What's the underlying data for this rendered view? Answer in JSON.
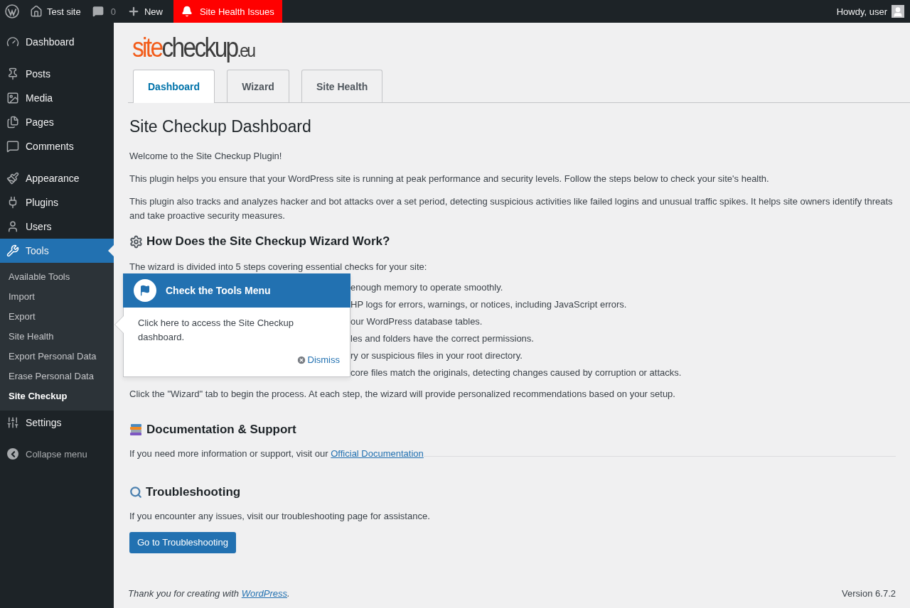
{
  "admin_bar": {
    "site": "Test site",
    "comments": "0",
    "new": "New",
    "alert": "Site Health Issues",
    "greeting": "Howdy, user"
  },
  "sidebar": {
    "groups": [
      [
        {
          "label": "Dashboard",
          "selected": false
        }
      ],
      [
        {
          "label": "Posts",
          "selected": false
        },
        {
          "label": "Media",
          "selected": false
        },
        {
          "label": "Pages",
          "selected": false
        },
        {
          "label": "Comments",
          "selected": false
        }
      ],
      [
        {
          "label": "Appearance",
          "selected": false
        },
        {
          "label": "Plugins",
          "selected": false
        },
        {
          "label": "Users",
          "selected": false
        },
        {
          "label": "Tools",
          "selected": true,
          "children": [
            {
              "label": "Available Tools",
              "selected": false
            },
            {
              "label": "Import",
              "selected": false
            },
            {
              "label": "Export",
              "selected": false
            },
            {
              "label": "Site Health",
              "selected": false
            },
            {
              "label": "Export Personal Data",
              "selected": false
            },
            {
              "label": "Erase Personal Data",
              "selected": false
            },
            {
              "label": "Site Checkup",
              "selected": true
            }
          ]
        },
        {
          "label": "Settings",
          "selected": false
        }
      ]
    ],
    "collapse": "Collapse menu"
  },
  "logo": {
    "part_1": "site",
    "part_2": "checkup",
    "part_3": ".eu"
  },
  "tabs": [
    {
      "label": "Dashboard",
      "selected": true
    },
    {
      "label": "Wizard",
      "selected": false
    },
    {
      "label": "Site Health",
      "selected": false
    }
  ],
  "title": "Site Checkup Dashboard",
  "intro": [
    "Welcome to the Site Checkup Plugin!",
    "This plugin helps you ensure that your WordPress site is running at peak performance and security levels. Follow the steps below to check your site's health.",
    "This plugin also tracks and analyzes hacker and bot attacks over a set period, detecting suspicious activities like failed logins and unusual traffic spikes. It helps site owners identify threats and take proactive security measures."
  ],
  "wizard": {
    "heading": "How Does the Site Checkup Wizard Work?",
    "lead": "The wizard is divided into 5 steps covering essential checks for your site:",
    "steps": [
      "enough memory to operate smoothly.",
      "HP logs for errors, warnings, or notices, including JavaScript errors.",
      "our WordPress database tables.",
      "les and folders have the correct permissions.",
      "ry or suspicious files in your root directory.",
      "core files match the originals, detecting changes caused by corruption or attacks."
    ],
    "outro": "Click the \"Wizard\" tab to begin the process. At each step, the wizard will provide personalized recommendations based on your setup."
  },
  "docs": {
    "heading": "Documentation & Support",
    "text": "If you need more information or support, visit our ",
    "link": "Official Documentation"
  },
  "troubleshooting": {
    "heading": "Troubleshooting",
    "text": "If you encounter any issues, visit our troubleshooting page for assistance.",
    "button": "Go to Troubleshooting"
  },
  "pointer": {
    "title": "Check the Tools Menu",
    "text": "Click here to access the Site Checkup dashboard.",
    "dismiss": "Dismiss"
  },
  "footer": {
    "text": "Thank you for creating with ",
    "link": "WordPress",
    "end": ".",
    "version": "Version 6.7.2"
  }
}
